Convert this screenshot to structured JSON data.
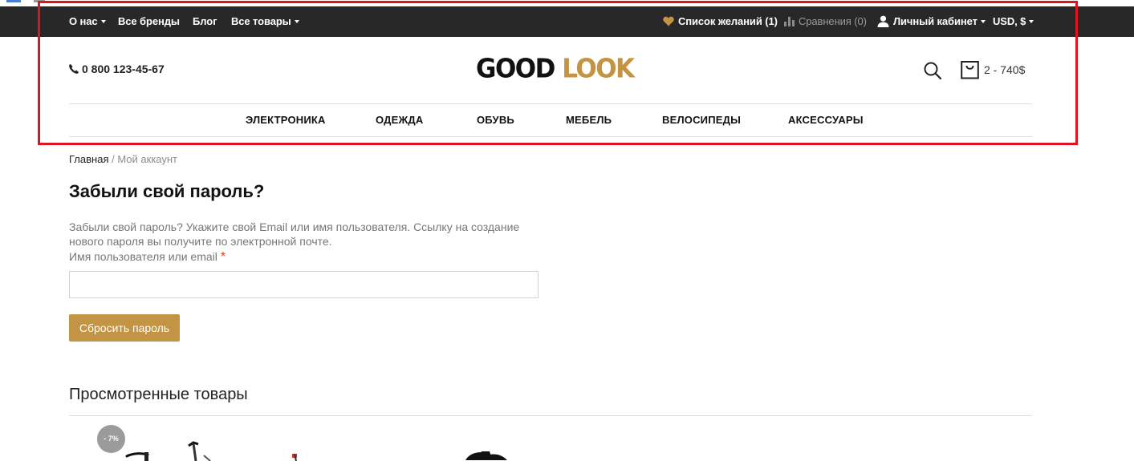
{
  "topbar": {
    "about": "О нас",
    "brands": "Все бренды",
    "blog": "Блог",
    "all_products": "Все товары",
    "wishlist": "Список желаний (1)",
    "compare": "Сравнения (0)",
    "account": "Личный кабинет",
    "currency": "USD, $"
  },
  "header": {
    "phone": "0 800 123-45-67",
    "logo_part1": "GOOD",
    "logo_part2": "LOOK",
    "cart_total": "2 - 740$"
  },
  "nav": {
    "items": [
      "ЭЛЕКТРОНИКА",
      "ОДЕЖДА",
      "ОБУВЬ",
      "МЕБЕЛЬ",
      "ВЕЛОСИПЕДЫ",
      "АКСЕССУАРЫ"
    ]
  },
  "breadcrumb": {
    "home": "Главная",
    "separator": " / ",
    "current": "Мой аккаунт"
  },
  "main": {
    "title": "Забыли свой пароль?",
    "description": "Забыли свой пароль? Укажите свой Email или имя пользователя. Ссылку на создание нового пароля вы получите по электронной почте.",
    "field_label": "Имя пользователя или email",
    "required_mark": "*",
    "input_value": "",
    "button_label": "Сбросить пароль"
  },
  "viewed": {
    "title": "Просмотренные товары",
    "badge": "- 7%"
  },
  "colors": {
    "accent": "#c39443",
    "topbar_bg": "#282828",
    "highlight": "#e0141e"
  }
}
